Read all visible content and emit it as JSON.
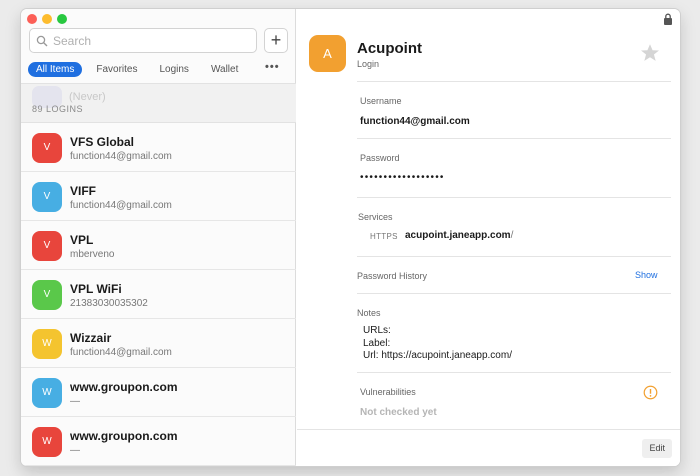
{
  "sidebar": {
    "search_placeholder": "Search",
    "add_label": "+",
    "tabs": [
      "All Items",
      "Favorites",
      "Logins",
      "Wallet"
    ],
    "more_label": "•••",
    "ghost_title": "(Never)",
    "count_label": "89 LOGINS",
    "items": [
      {
        "letter": "V",
        "title": "VFS Global",
        "subtitle": "function44@gmail.com",
        "color": "#e8453c"
      },
      {
        "letter": "V",
        "title": "VIFF",
        "subtitle": "function44@gmail.com",
        "color": "#47aee3"
      },
      {
        "letter": "V",
        "title": "VPL",
        "subtitle": "mberveno",
        "color": "#e8453c"
      },
      {
        "letter": "V",
        "title": "VPL WiFi",
        "subtitle": "21383030035302",
        "color": "#5ac84a"
      },
      {
        "letter": "W",
        "title": "Wizzair",
        "subtitle": "function44@gmail.com",
        "color": "#f4c42f"
      },
      {
        "letter": "W",
        "title": "www.groupon.com",
        "subtitle": "—",
        "color": "#47aee3"
      },
      {
        "letter": "W",
        "title": "www.groupon.com",
        "subtitle": "—",
        "color": "#e8453c"
      }
    ]
  },
  "detail": {
    "letter": "A",
    "title": "Acupoint",
    "type": "Login",
    "accent": "#f2a030",
    "username_label": "Username",
    "username_value": "function44@gmail.com",
    "password_label": "Password",
    "password_value": "••••••••••••••••••",
    "services_label": "Services",
    "service_protocol": "HTTPS",
    "service_host": "acupoint.janeapp.com",
    "service_suffix": "/",
    "history_label": "Password History",
    "history_action": "Show",
    "notes_label": "Notes",
    "notes_lines": [
      "URLs:",
      "Label:",
      "Url: https://acupoint.janeapp.com/"
    ],
    "vuln_label": "Vulnerabilities",
    "vuln_value": "Not checked yet",
    "edit_label": "Edit"
  }
}
